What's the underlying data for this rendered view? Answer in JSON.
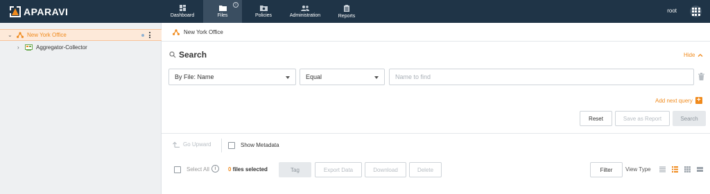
{
  "topbar": {
    "logo_text": "APARAVI",
    "nav": [
      {
        "label": "Dashboard",
        "icon": "dashboard-icon"
      },
      {
        "label": "Files",
        "icon": "folder-icon",
        "active": true,
        "info": "i"
      },
      {
        "label": "Policies",
        "icon": "policies-icon"
      },
      {
        "label": "Administration",
        "icon": "users-icon"
      },
      {
        "label": "Reports",
        "icon": "reports-icon"
      }
    ],
    "user": "root",
    "apps_icon": "apps-grid-icon"
  },
  "sidebar": {
    "items": [
      {
        "label": "New York Office",
        "icon": "network-icon",
        "selected": true
      },
      {
        "label": "Aggregator-Collector",
        "icon": "collector-icon"
      }
    ]
  },
  "breadcrumb": {
    "label": "New York Office",
    "icon": "network-icon"
  },
  "search": {
    "title": "Search",
    "hide_label": "Hide",
    "field_select": "By File: Name",
    "operator_select": "Equal",
    "value_placeholder": "Name to find",
    "add_query_label": "Add next query",
    "add_query_icon": "+",
    "reset_label": "Reset",
    "save_report_label": "Save as Report",
    "search_label": "Search"
  },
  "toolbar": {
    "go_upward_label": "Go Upward",
    "show_metadata_label": "Show Metadata",
    "select_all_label": "Select All",
    "select_all_info": "i",
    "files_selected_count": "0",
    "files_selected_label": "files selected",
    "tag_label": "Tag",
    "export_label": "Export Data",
    "download_label": "Download",
    "delete_label": "Delete",
    "filter_label": "Filter",
    "view_type_label": "View Type"
  },
  "colors": {
    "accent": "#f08a1c",
    "topbar": "#1f3447",
    "sidebar": "#eef0f2"
  }
}
